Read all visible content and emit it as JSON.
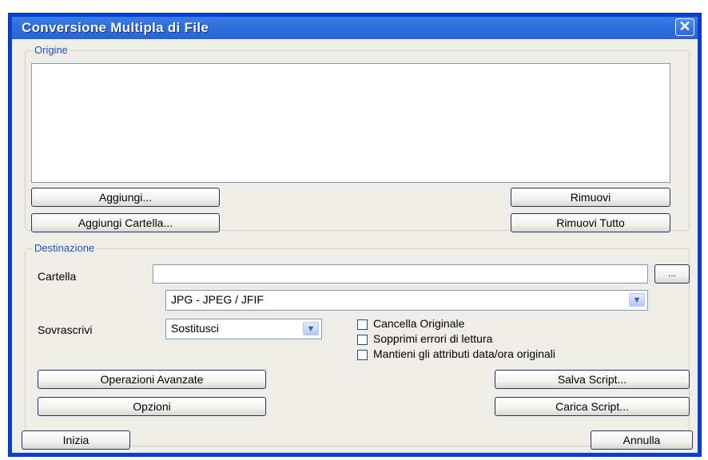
{
  "window": {
    "title": "Conversione Multipla di File",
    "close_icon": "close-icon"
  },
  "origine": {
    "label": "Origine",
    "add_button": "Aggiungi...",
    "add_folder_button": "Aggiungi Cartella...",
    "remove_button": "Rimuovi",
    "remove_all_button": "Rimuovi Tutto"
  },
  "destinazione": {
    "label": "Destinazione",
    "folder_label": "Cartella",
    "folder_value": "",
    "browse_button": "...",
    "format_value": "JPG - JPEG / JFIF",
    "overwrite_label": "Sovrascrivi",
    "overwrite_value": "Sostitusci",
    "checkboxes": [
      {
        "label": "Cancella Originale",
        "checked": false
      },
      {
        "label": "Sopprimi errori di lettura",
        "checked": false
      },
      {
        "label": "Mantieni gli attributi data/ora originali",
        "checked": false
      }
    ],
    "advanced_button": "Operazioni Avanzate",
    "options_button": "Opzioni",
    "save_script_button": "Salva Script...",
    "load_script_button": "Carica Script..."
  },
  "footer": {
    "start_button": "Inizia",
    "cancel_button": "Annulla"
  }
}
